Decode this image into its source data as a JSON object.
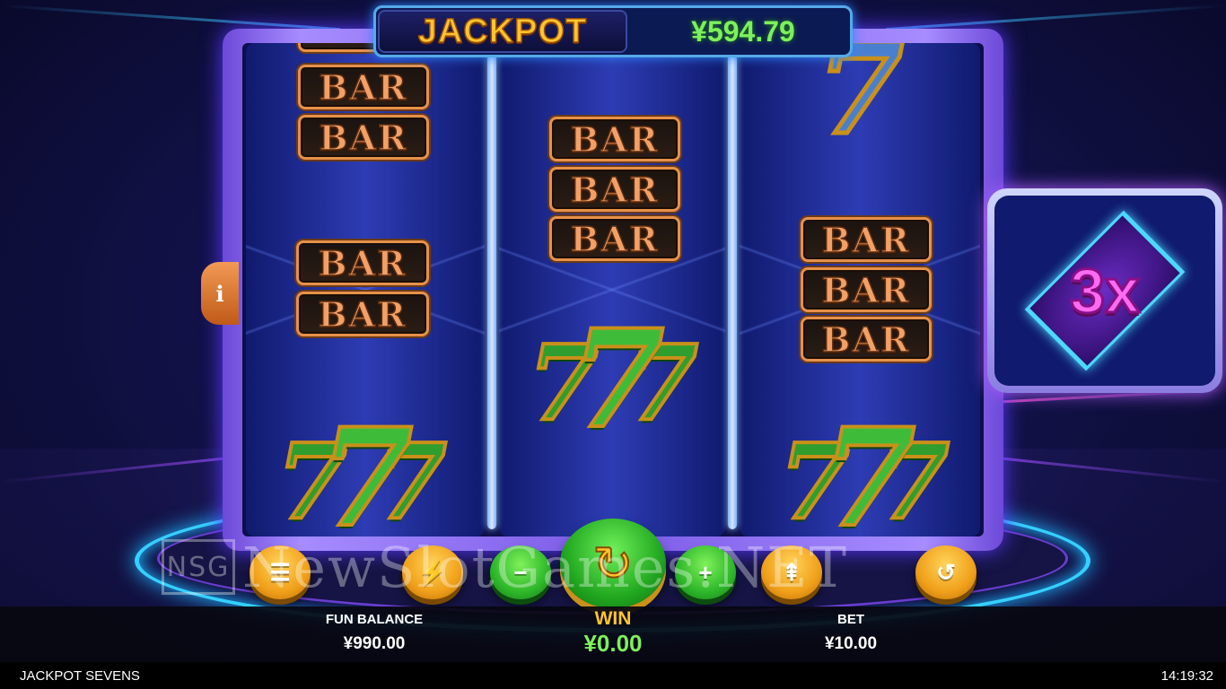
{
  "jackpot": {
    "label": "JACKPOT",
    "amount": "¥594.79"
  },
  "reels": [
    {
      "symbols": [
        "BAR",
        "BAR",
        "BAR",
        "BAR",
        "777"
      ]
    },
    {
      "symbols": [
        "BAR",
        "BAR",
        "BAR",
        "777"
      ]
    },
    {
      "symbols": [
        "7",
        "BAR",
        "BAR",
        "BAR",
        "777"
      ]
    }
  ],
  "multiplier": {
    "value": "3x"
  },
  "info_button": {
    "glyph": "i"
  },
  "controls": {
    "menu_icon": "menu-icon",
    "turbo_icon": "lightning-icon",
    "decrease_glyph": "−",
    "spin_icon": "refresh-icon",
    "increase_glyph": "+",
    "stack_icon": "coin-stack-icon",
    "autoplay_icon": "autoplay-icon"
  },
  "info_bar": {
    "balance_label": "FUN BALANCE",
    "balance_value": "¥990.00",
    "win_label": "WIN",
    "win_value": "¥0.00",
    "bet_label": "BET",
    "bet_value": "¥10.00"
  },
  "status_bar": {
    "game_title": "JACKPOT SEVENS",
    "clock": "14:19:32"
  },
  "watermark": {
    "logo": "NSG",
    "text": "NewSlotGames.NET"
  },
  "colors": {
    "accent_gold": "#ffc52e",
    "win_green": "#7df05b",
    "frame_purple": "#7b5ae6",
    "multiplier_pink": "#ff6bf0"
  }
}
